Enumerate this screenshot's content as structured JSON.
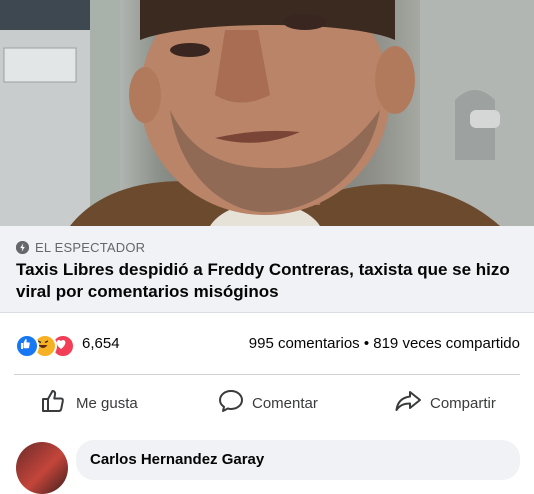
{
  "post": {
    "source": "EL ESPECTADOR",
    "headline": "Taxis Libres despidió a Freddy Contreras, taxista que se hizo viral por comentarios misóginos"
  },
  "stats": {
    "reactions": [
      "like",
      "haha",
      "love"
    ],
    "reaction_count": "6,654",
    "comments_shares": "995 comentarios • 819 veces compartido"
  },
  "actions": {
    "like": "Me gusta",
    "comment": "Comentar",
    "share": "Compartir"
  },
  "comment": {
    "author": "Carlos Hernandez Garay"
  },
  "colors": {
    "like_blue": "#1877f2",
    "haha_yellow": "#f7b125",
    "love_red": "#f33e58",
    "link_box_bg": "#f0f2f5",
    "muted_text": "#65676b"
  }
}
